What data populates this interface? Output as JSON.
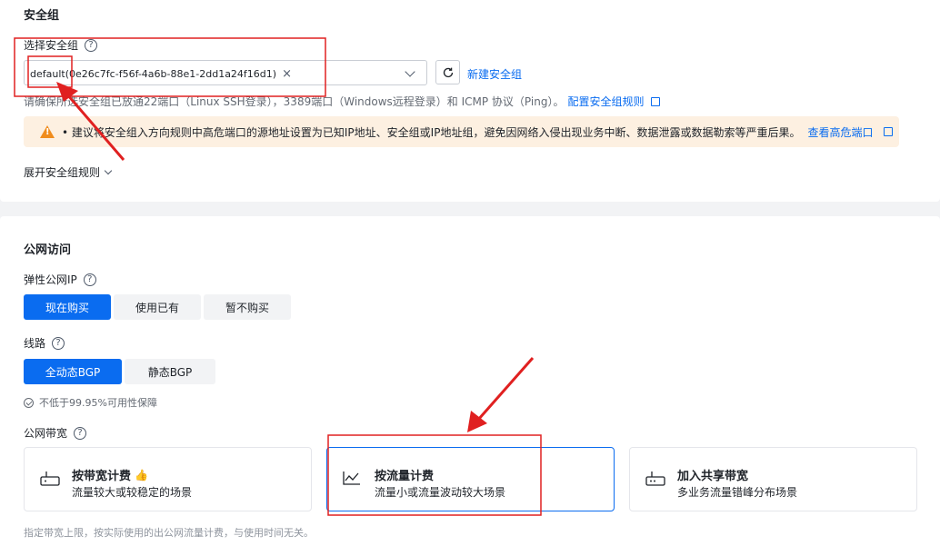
{
  "security_group": {
    "title": "安全组",
    "select_label": "选择安全组",
    "help_glyph": "?",
    "selected_tag": "default(0e26c7fc-f56f-4a6b-88e1-2dd1a24f16d1)",
    "tag_close": "×",
    "new_link": "新建安全组",
    "hint_prefix": "请确保所选安全组已放通22端口（Linux SSH登录），3389端口（Windows远程登录）和 ICMP 协议（Ping）。",
    "hint_link": "配置安全组规则",
    "warning_text": "• 建议将安全组入方向规则中高危端口的源地址设置为已知IP地址、安全组或IP地址组，避免因网络入侵出现业务中断、数据泄露或数据勒索等严重后果。",
    "warning_link": "查看高危端口",
    "expand_label": "展开安全组规则"
  },
  "public_access": {
    "title": "公网访问",
    "eip_label": "弹性公网IP",
    "eip_options": [
      "现在购买",
      "使用已有",
      "暂不购买"
    ],
    "eip_selected": "现在购买",
    "line_label": "线路",
    "line_options": [
      "全动态BGP",
      "静态BGP"
    ],
    "line_selected": "全动态BGP",
    "availability_note": "不低于99.95%可用性保障",
    "bandwidth_label": "公网带宽",
    "billing_cards": [
      {
        "title": "按带宽计费",
        "desc": "流量较大或较稳定的场景",
        "badge": "👍",
        "selected": false
      },
      {
        "title": "按流量计费",
        "desc": "流量小或流量波动较大场景",
        "badge": "",
        "selected": true
      },
      {
        "title": "加入共享带宽",
        "desc": "多业务流量错峰分布场景",
        "badge": "",
        "selected": false
      }
    ],
    "footer_note": "指定带宽上限，按实际使用的出公网流量计费，与使用时间无关。"
  },
  "colors": {
    "accent": "#0a6cf0",
    "warning_bg": "#fdf0e1",
    "annotation_red": "#e02020"
  }
}
